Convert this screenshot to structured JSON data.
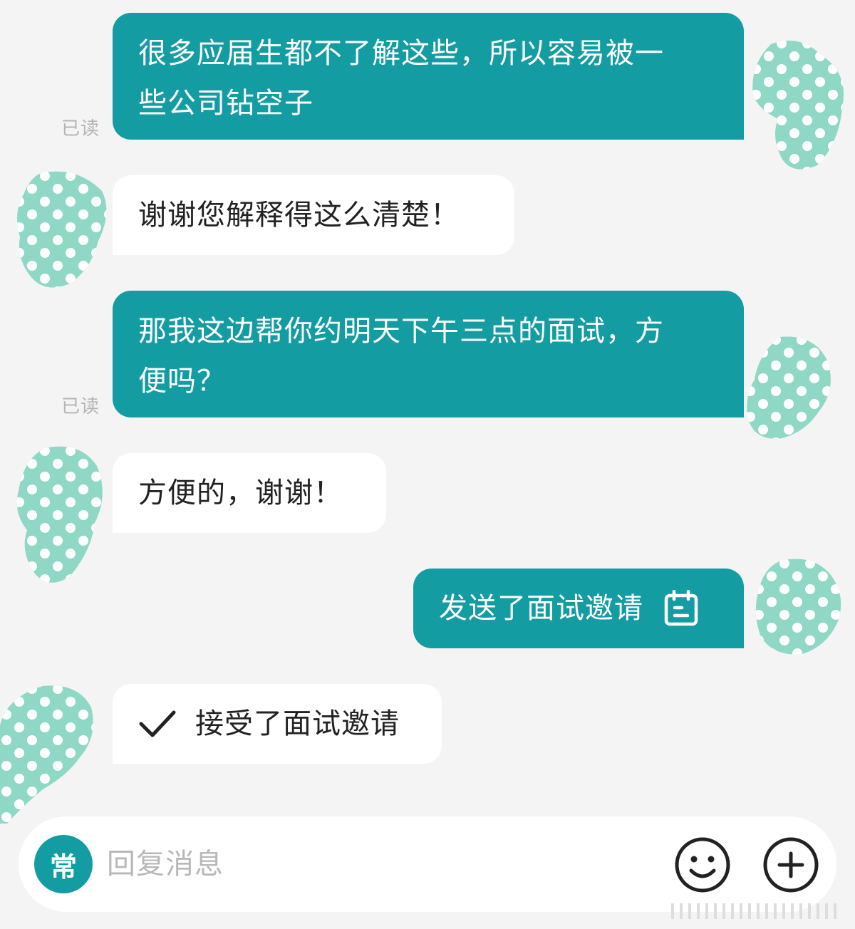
{
  "messages": [
    {
      "side": "out",
      "text_lines": [
        "很多应届生都不了解这些，所以容易被一",
        "些公司钻空子"
      ],
      "read_label": "已读"
    },
    {
      "side": "in",
      "text": "谢谢您解释得这么清楚！"
    },
    {
      "side": "out",
      "text_lines": [
        "那我这边帮你约明天下午三点的面试，方",
        "便吗？"
      ],
      "read_label": "已读"
    },
    {
      "side": "in",
      "text": "方便的，谢谢！"
    },
    {
      "side": "out",
      "text": "发送了面试邀请",
      "icon": "calendar-icon"
    },
    {
      "side": "in",
      "text": "接受了面试邀请",
      "icon": "checkmark-icon"
    }
  ],
  "input_bar": {
    "common_phrases_label": "常",
    "placeholder": "回复消息",
    "emoji_icon": "smiley-icon",
    "more_icon": "plus-circle-icon"
  },
  "colors": {
    "accent": "#149ca3",
    "background": "#f4f4f4",
    "incoming_bubble": "#ffffff",
    "avatar_blur": "#8fd8c6"
  }
}
